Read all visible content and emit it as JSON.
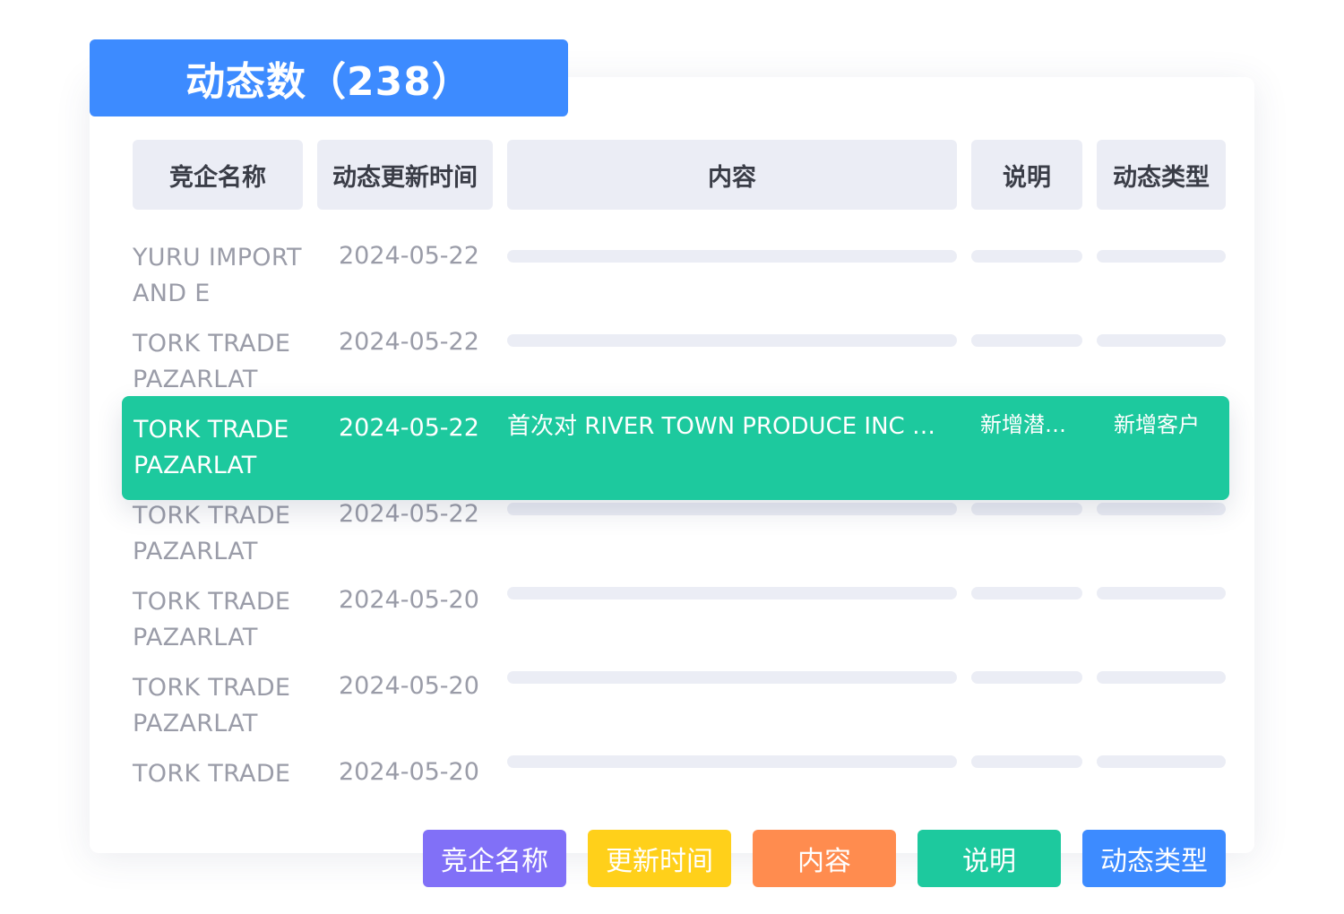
{
  "title": "动态数（238）",
  "columns": [
    "竞企名称",
    "动态更新时间",
    "内容",
    "说明",
    "动态类型"
  ],
  "rows": [
    {
      "company": "YURU IMPORT AND E",
      "date": "2024-05-22"
    },
    {
      "company": "TORK TRADE PAZARLAT",
      "date": "2024-05-22"
    },
    {
      "company": "TORK TRADE PAZARLAT",
      "date": "2024-05-22"
    },
    {
      "company": "TORK TRADE PAZARLAT",
      "date": "2024-05-20"
    },
    {
      "company": "TORK TRADE PAZARLAT",
      "date": "2024-05-20"
    },
    {
      "company": "TORK TRADE",
      "date": "2024-05-20"
    }
  ],
  "highlighted_row": {
    "company": "TORK TRADE PAZARLAT",
    "date": "2024-05-22",
    "content": "首次对 RIVER TOWN PRODUCE INC 供…",
    "note": "新增潜…",
    "type": "新增客户"
  },
  "legend": [
    {
      "label": "竞企名称",
      "color": "#8170f7"
    },
    {
      "label": "更新时间",
      "color": "#ffd01a"
    },
    {
      "label": "内容",
      "color": "#ff8c4f"
    },
    {
      "label": "说明",
      "color": "#1dc99e"
    },
    {
      "label": "动态类型",
      "color": "#3d8bff"
    }
  ],
  "colors": {
    "title_bg": "#3d8bff",
    "header_bg": "#ebedf5",
    "highlight_bg": "#1dc99e",
    "muted_text": "#9a9ca8"
  }
}
